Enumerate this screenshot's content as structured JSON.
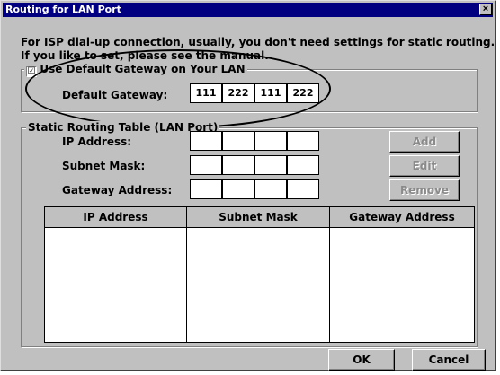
{
  "window": {
    "title": "Routing for LAN Port",
    "close_glyph": "×"
  },
  "intro": {
    "line1": "For ISP dial-up connection, usually, you don't need settings for static routing.",
    "line2": "If you like to set, please see the manual."
  },
  "default_gateway_group": {
    "checkbox_label": "Use Default Gateway on Your LAN",
    "checked": true,
    "check_glyph": "☑",
    "field_label": "Default Gateway:",
    "octets": [
      "111",
      "222",
      "111",
      "222"
    ]
  },
  "static_routing": {
    "group_label": "Static Routing Table (LAN Port)",
    "ip_label": "IP Address:",
    "subnet_label": "Subnet Mask:",
    "gateway_label": "Gateway Address:",
    "buttons": {
      "add": "Add",
      "edit": "Edit",
      "remove": "Remove"
    },
    "table_headers": [
      "IP Address",
      "Subnet Mask",
      "Gateway Address"
    ],
    "rows": []
  },
  "footer": {
    "ok": "OK",
    "cancel": "Cancel"
  }
}
